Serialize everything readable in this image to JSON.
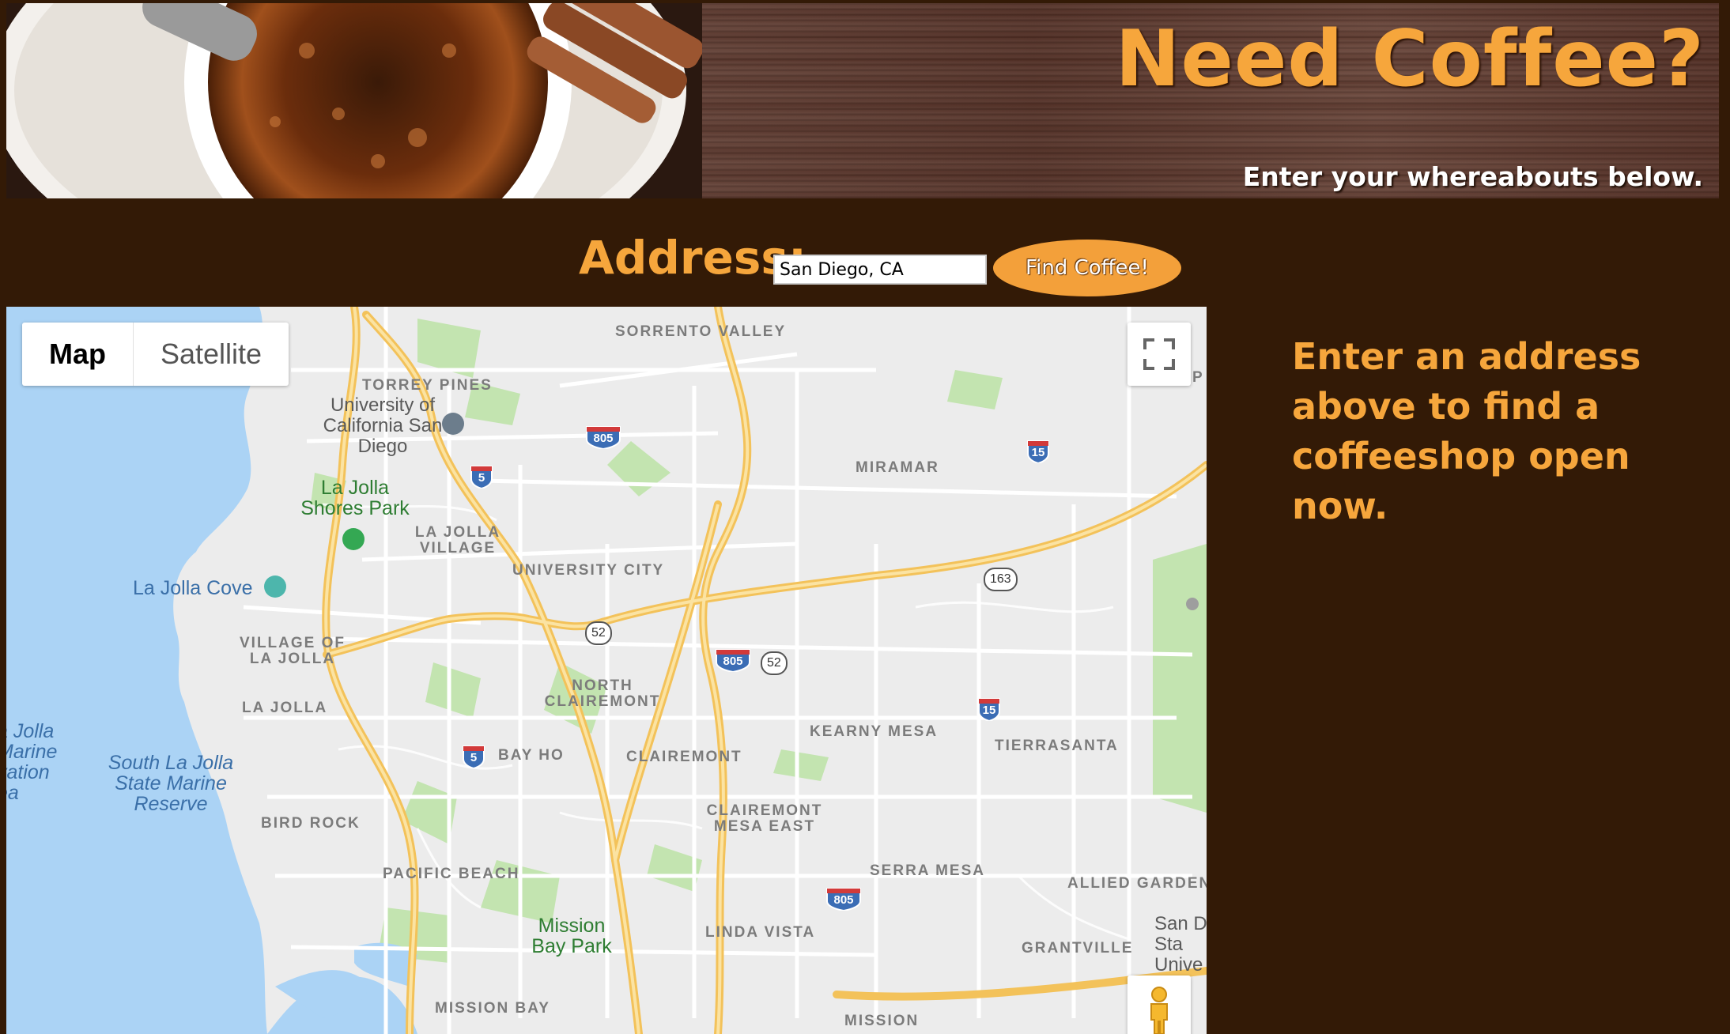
{
  "header": {
    "title": "Need Coffee?",
    "subtitle": "Enter your whereabouts below."
  },
  "search": {
    "label": "Address:",
    "value": "San Diego, CA",
    "button_label": "Find Coffee!"
  },
  "map": {
    "type_controls": [
      "Map",
      "Satellite"
    ],
    "selected_type": "Map",
    "labels": {
      "sorrento_valley": "SORRENTO VALLEY",
      "torrey_pines": "TORREY PINES",
      "ucsd": "University of California San Diego",
      "la_jolla_shores_park": "La Jolla Shores Park",
      "la_jolla_village": "LA JOLLA VILLAGE",
      "university_city": "UNIVERSITY CITY",
      "miramar": "MIRAMAR",
      "la_jolla_cove": "La Jolla Cove",
      "village_of_la_jolla": "VILLAGE OF LA JOLLA",
      "la_jolla": "LA JOLLA",
      "north_clairemont": "NORTH CLAIREMONT",
      "kearny_mesa": "KEARNY MESA",
      "tierrasanta": "TIERRASANTA",
      "bay_ho": "BAY HO",
      "clairemont": "CLAIREMONT",
      "la_jolla_reserve": "a Jolla Marine vation ea",
      "south_la_jolla_reserve": "South La Jolla State Marine Reserve",
      "bird_rock": "BIRD ROCK",
      "clairemont_mesa_east": "CLAIREMONT MESA EAST",
      "pacific_beach": "PACIFIC BEACH",
      "serra_mesa": "SERRA MESA",
      "allied_gardens": "ALLIED GARDENS",
      "mission_bay_park": "Mission Bay Park",
      "linda_vista": "LINDA VISTA",
      "grantville": "GRANTVILLE",
      "sdsu": "San D Sta Unive",
      "mission_bay": "MISSION BAY",
      "mission_valley_east": "MISSION",
      "edge_p": "P"
    },
    "shields": {
      "i805_a": "805",
      "i805_b": "805",
      "i805_c": "805",
      "i5_a": "5",
      "i5_b": "5",
      "i15_a": "15",
      "i15_b": "15",
      "sr52_a": "52",
      "sr52_b": "52",
      "sr163": "163"
    },
    "colors": {
      "water": "#abd3f5",
      "land": "#ececec",
      "park": "#c3e4b0",
      "highway": "#f9d27a"
    }
  },
  "sidebar": {
    "message": "Enter an address above to find a coffeeshop open now."
  },
  "colors": {
    "background": "#331a06",
    "accent": "#f6a63c"
  }
}
